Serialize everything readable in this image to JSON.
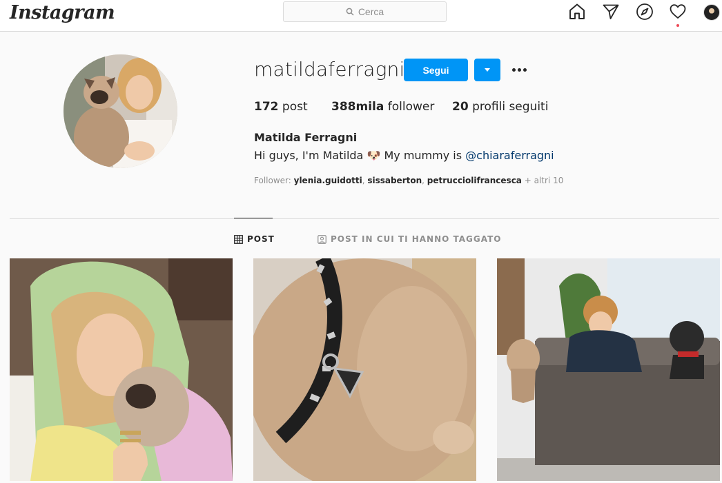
{
  "app": {
    "logo": "Instagram"
  },
  "search": {
    "placeholder": "Cerca"
  },
  "nav": {
    "icons": [
      "home-icon",
      "direct-icon",
      "explore-icon",
      "activity-icon",
      "profile-avatar"
    ]
  },
  "profile": {
    "username": "matildaferragni",
    "follow_label": "Segui",
    "stats": {
      "posts_count": "172",
      "posts_label": "post",
      "followers_count": "388mila",
      "followers_label": "follower",
      "following_count": "20",
      "following_label": "profili seguiti"
    },
    "full_name": "Matilda Ferragni",
    "bio_text": "Hi guys, I'm Matilda 🐶 My mummy is ",
    "bio_mention": "@chiaraferragni",
    "followed_by_label": "Follower:",
    "followed_by_users": [
      "ylenia.guidotti",
      "sissaberton",
      "petrucciolifrancesca"
    ],
    "followed_by_more": "+ altri 10"
  },
  "tabs": [
    {
      "label": "POST",
      "active": true
    },
    {
      "label": "POST IN CUI TI HANNO TAGGATO",
      "active": false
    }
  ],
  "colors": {
    "accent": "#0095f6",
    "link": "#00376b",
    "notification": "#ed4956"
  }
}
